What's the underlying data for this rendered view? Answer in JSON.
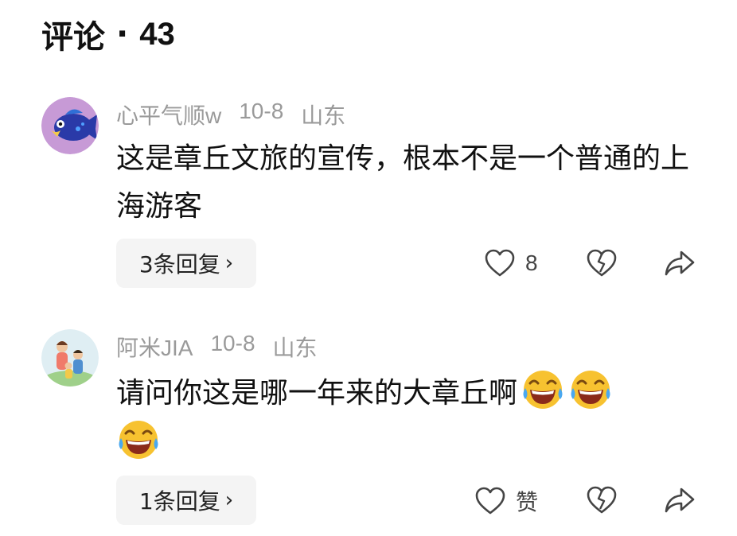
{
  "header": {
    "title": "评论",
    "separator": "·",
    "count": "43"
  },
  "comments": [
    {
      "username": "心平气顺w",
      "date": "10-8",
      "location": "山东",
      "text": "这是章丘文旅的宣传，根本不是一个普通的上海游客",
      "reply_button": "3条回复",
      "like_count": "8",
      "avatar_icon": "cartoon-fish-avatar"
    },
    {
      "username": "阿米JIA",
      "date": "10-8",
      "location": "山东",
      "text": "请问你这是哪一年来的大章丘啊",
      "emojis": [
        "laughing-tears-emoji",
        "laughing-tears-emoji",
        "laughing-tears-emoji"
      ],
      "reply_button": "1条回复",
      "like_label": "赞",
      "avatar_icon": "illustrated-family-avatar"
    }
  ],
  "icons": {
    "like": "heart-outline-icon",
    "dislike": "broken-heart-icon",
    "share": "share-arrow-icon",
    "chevron": "chevron-right-icon"
  }
}
